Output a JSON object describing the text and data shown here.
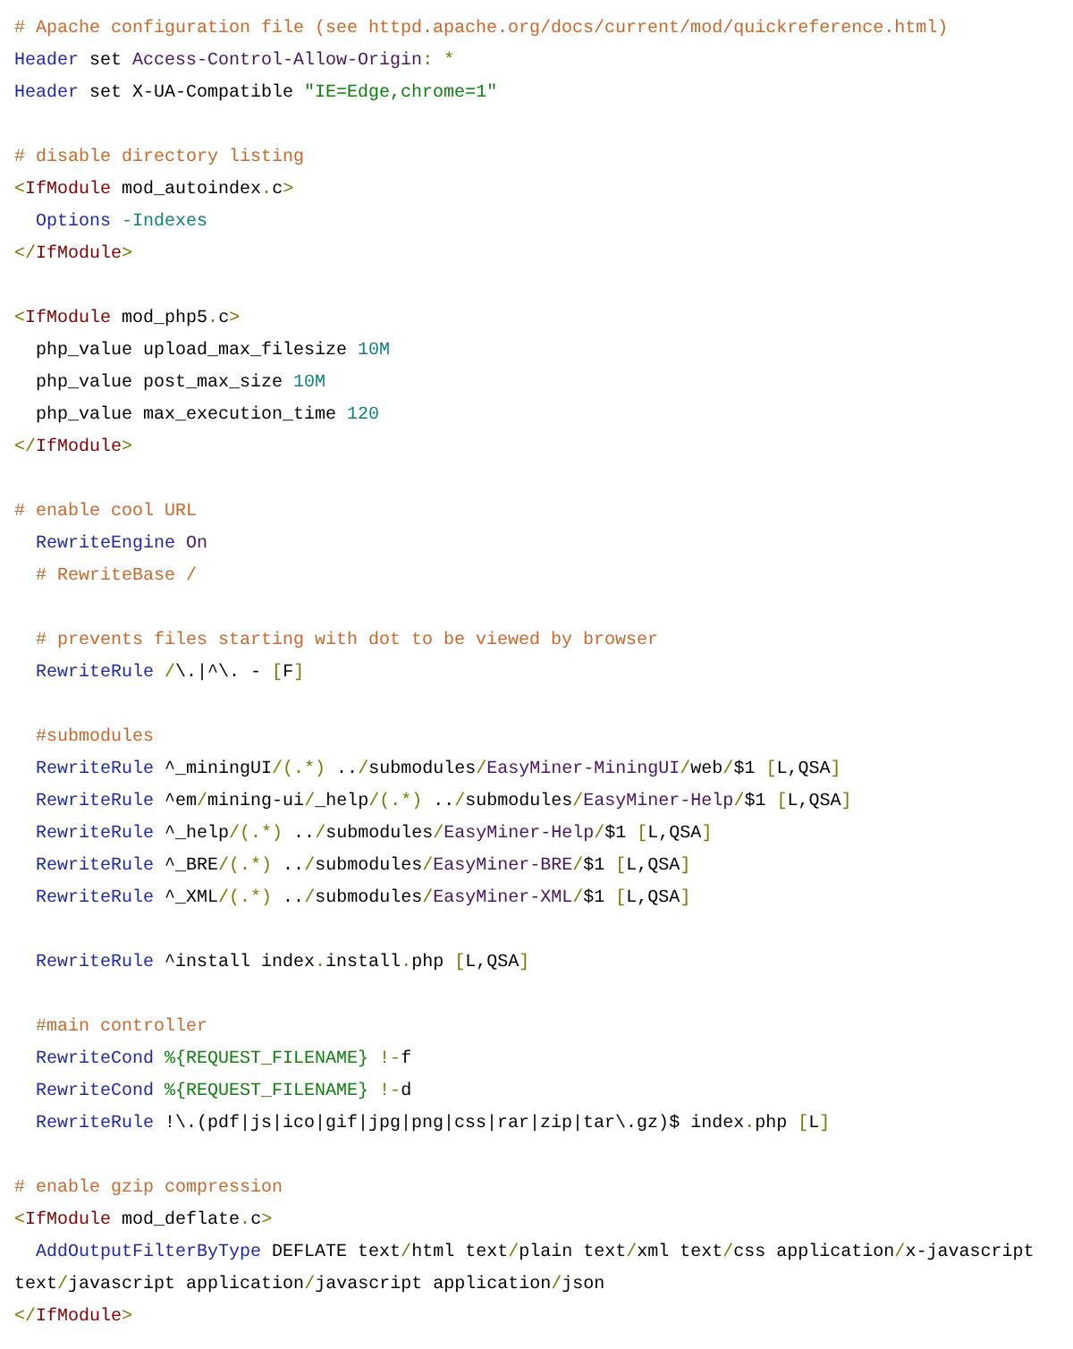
{
  "code_blocks": [
    {
      "lines": [
        {
          "indented": false,
          "tokens": [
            {
              "kind": "comment",
              "text": "# Apache configuration file (see httpd.apache.org/docs/current/mod/quickreference.html)"
            }
          ]
        },
        {
          "indented": false,
          "tokens": [
            {
              "kind": "keyword",
              "text": "Header"
            },
            {
              "kind": "text",
              "text": " set "
            },
            {
              "kind": "value",
              "text": "Access-Control-Allow-Origin"
            },
            {
              "kind": "punct",
              "text": ": *"
            }
          ]
        },
        {
          "indented": false,
          "tokens": [
            {
              "kind": "keyword",
              "text": "Header"
            },
            {
              "kind": "text",
              "text": " set X-UA-Compatible "
            },
            {
              "kind": "string",
              "text": "\"IE=Edge,chrome=1\""
            }
          ]
        }
      ]
    },
    {
      "lines": [
        {
          "indented": false,
          "tokens": [
            {
              "kind": "comment",
              "text": "# disable directory listing"
            }
          ]
        },
        {
          "indented": false,
          "tokens": [
            {
              "kind": "punct",
              "text": "<"
            },
            {
              "kind": "tag",
              "text": "IfModule"
            },
            {
              "kind": "text",
              "text": " mod_autoindex"
            },
            {
              "kind": "punct",
              "text": "."
            },
            {
              "kind": "text",
              "text": "c"
            },
            {
              "kind": "punct",
              "text": ">"
            }
          ]
        },
        {
          "indented": true,
          "tokens": [
            {
              "kind": "keyword",
              "text": "Options"
            },
            {
              "kind": "number",
              "text": " -Indexes"
            }
          ]
        },
        {
          "indented": false,
          "tokens": [
            {
              "kind": "punct",
              "text": "</"
            },
            {
              "kind": "tag",
              "text": "IfModule"
            },
            {
              "kind": "punct",
              "text": ">"
            }
          ]
        }
      ]
    },
    {
      "lines": [
        {
          "indented": false,
          "tokens": [
            {
              "kind": "punct",
              "text": "<"
            },
            {
              "kind": "tag",
              "text": "IfModule"
            },
            {
              "kind": "text",
              "text": " mod_php5"
            },
            {
              "kind": "punct",
              "text": "."
            },
            {
              "kind": "text",
              "text": "c"
            },
            {
              "kind": "punct",
              "text": ">"
            }
          ]
        },
        {
          "indented": true,
          "tokens": [
            {
              "kind": "text",
              "text": "php_value upload_max_filesize "
            },
            {
              "kind": "number",
              "text": "10M"
            }
          ]
        },
        {
          "indented": true,
          "tokens": [
            {
              "kind": "text",
              "text": "php_value post_max_size "
            },
            {
              "kind": "number",
              "text": "10M"
            }
          ]
        },
        {
          "indented": true,
          "tokens": [
            {
              "kind": "text",
              "text": "php_value max_execution_time "
            },
            {
              "kind": "number",
              "text": "120"
            }
          ]
        },
        {
          "indented": false,
          "tokens": [
            {
              "kind": "punct",
              "text": "</"
            },
            {
              "kind": "tag",
              "text": "IfModule"
            },
            {
              "kind": "punct",
              "text": ">"
            }
          ]
        }
      ]
    },
    {
      "lines": [
        {
          "indented": false,
          "tokens": [
            {
              "kind": "comment",
              "text": "# enable cool URL"
            }
          ]
        },
        {
          "indented": true,
          "tokens": [
            {
              "kind": "keyword",
              "text": "RewriteEngine"
            },
            {
              "kind": "value",
              "text": " On"
            }
          ]
        },
        {
          "indented": true,
          "tokens": [
            {
              "kind": "comment",
              "text": "# RewriteBase /"
            }
          ]
        }
      ]
    },
    {
      "lines": [
        {
          "indented": true,
          "tokens": [
            {
              "kind": "comment",
              "text": "# prevents files starting with dot to be viewed by browser"
            }
          ]
        },
        {
          "indented": true,
          "tokens": [
            {
              "kind": "keyword",
              "text": "RewriteRule"
            },
            {
              "kind": "punct",
              "text": " /"
            },
            {
              "kind": "text",
              "text": "\\.|^\\. - "
            },
            {
              "kind": "punct",
              "text": "["
            },
            {
              "kind": "text",
              "text": "F"
            },
            {
              "kind": "punct",
              "text": "]"
            }
          ]
        }
      ]
    },
    {
      "lines": [
        {
          "indented": true,
          "tokens": [
            {
              "kind": "comment",
              "text": "#submodules"
            }
          ]
        },
        {
          "indented": true,
          "tokens": [
            {
              "kind": "keyword",
              "text": "RewriteRule"
            },
            {
              "kind": "text",
              "text": " ^_miningUI"
            },
            {
              "kind": "punct",
              "text": "/(.*)"
            },
            {
              "kind": "text",
              "text": " .."
            },
            {
              "kind": "punct",
              "text": "/"
            },
            {
              "kind": "text",
              "text": "submodules"
            },
            {
              "kind": "punct",
              "text": "/"
            },
            {
              "kind": "value",
              "text": "EasyMiner-MiningUI"
            },
            {
              "kind": "punct",
              "text": "/"
            },
            {
              "kind": "text",
              "text": "web"
            },
            {
              "kind": "punct",
              "text": "/"
            },
            {
              "kind": "text",
              "text": "$1 "
            },
            {
              "kind": "punct",
              "text": "["
            },
            {
              "kind": "text",
              "text": "L,QSA"
            },
            {
              "kind": "punct",
              "text": "]"
            }
          ]
        },
        {
          "indented": true,
          "tokens": [
            {
              "kind": "keyword",
              "text": "RewriteRule"
            },
            {
              "kind": "text",
              "text": " ^em"
            },
            {
              "kind": "punct",
              "text": "/"
            },
            {
              "kind": "text",
              "text": "mining-ui"
            },
            {
              "kind": "punct",
              "text": "/"
            },
            {
              "kind": "text",
              "text": "_help"
            },
            {
              "kind": "punct",
              "text": "/(.*)"
            },
            {
              "kind": "text",
              "text": " .."
            },
            {
              "kind": "punct",
              "text": "/"
            },
            {
              "kind": "text",
              "text": "submodules"
            },
            {
              "kind": "punct",
              "text": "/"
            },
            {
              "kind": "value",
              "text": "EasyMiner-Help"
            },
            {
              "kind": "punct",
              "text": "/"
            },
            {
              "kind": "text",
              "text": "$1 "
            },
            {
              "kind": "punct",
              "text": "["
            },
            {
              "kind": "text",
              "text": "L,QSA"
            },
            {
              "kind": "punct",
              "text": "]"
            }
          ]
        },
        {
          "indented": true,
          "tokens": [
            {
              "kind": "keyword",
              "text": "RewriteRule"
            },
            {
              "kind": "text",
              "text": " ^_help"
            },
            {
              "kind": "punct",
              "text": "/(.*)"
            },
            {
              "kind": "text",
              "text": " .."
            },
            {
              "kind": "punct",
              "text": "/"
            },
            {
              "kind": "text",
              "text": "submodules"
            },
            {
              "kind": "punct",
              "text": "/"
            },
            {
              "kind": "value",
              "text": "EasyMiner-Help"
            },
            {
              "kind": "punct",
              "text": "/"
            },
            {
              "kind": "text",
              "text": "$1 "
            },
            {
              "kind": "punct",
              "text": "["
            },
            {
              "kind": "text",
              "text": "L,QSA"
            },
            {
              "kind": "punct",
              "text": "]"
            }
          ]
        },
        {
          "indented": true,
          "tokens": [
            {
              "kind": "keyword",
              "text": "RewriteRule"
            },
            {
              "kind": "text",
              "text": " ^_BRE"
            },
            {
              "kind": "punct",
              "text": "/(.*)"
            },
            {
              "kind": "text",
              "text": " .."
            },
            {
              "kind": "punct",
              "text": "/"
            },
            {
              "kind": "text",
              "text": "submodules"
            },
            {
              "kind": "punct",
              "text": "/"
            },
            {
              "kind": "value",
              "text": "EasyMiner-BRE"
            },
            {
              "kind": "punct",
              "text": "/"
            },
            {
              "kind": "text",
              "text": "$1 "
            },
            {
              "kind": "punct",
              "text": "["
            },
            {
              "kind": "text",
              "text": "L,QSA"
            },
            {
              "kind": "punct",
              "text": "]"
            }
          ]
        },
        {
          "indented": true,
          "tokens": [
            {
              "kind": "keyword",
              "text": "RewriteRule"
            },
            {
              "kind": "text",
              "text": " ^_XML"
            },
            {
              "kind": "punct",
              "text": "/(.*)"
            },
            {
              "kind": "text",
              "text": " .."
            },
            {
              "kind": "punct",
              "text": "/"
            },
            {
              "kind": "text",
              "text": "submodules"
            },
            {
              "kind": "punct",
              "text": "/"
            },
            {
              "kind": "value",
              "text": "EasyMiner-XML"
            },
            {
              "kind": "punct",
              "text": "/"
            },
            {
              "kind": "text",
              "text": "$1 "
            },
            {
              "kind": "punct",
              "text": "["
            },
            {
              "kind": "text",
              "text": "L,QSA"
            },
            {
              "kind": "punct",
              "text": "]"
            }
          ]
        }
      ]
    },
    {
      "lines": [
        {
          "indented": true,
          "tokens": [
            {
              "kind": "keyword",
              "text": "RewriteRule"
            },
            {
              "kind": "text",
              "text": " ^install index"
            },
            {
              "kind": "punct",
              "text": "."
            },
            {
              "kind": "text",
              "text": "install"
            },
            {
              "kind": "punct",
              "text": "."
            },
            {
              "kind": "text",
              "text": "php "
            },
            {
              "kind": "punct",
              "text": "["
            },
            {
              "kind": "text",
              "text": "L,QSA"
            },
            {
              "kind": "punct",
              "text": "]"
            }
          ]
        }
      ]
    },
    {
      "lines": [
        {
          "indented": true,
          "tokens": [
            {
              "kind": "comment",
              "text": "#main controller"
            }
          ]
        },
        {
          "indented": true,
          "tokens": [
            {
              "kind": "keyword",
              "text": "RewriteCond"
            },
            {
              "kind": "string",
              "text": " %{REQUEST_FILENAME}"
            },
            {
              "kind": "punct",
              "text": " !-"
            },
            {
              "kind": "text",
              "text": "f"
            }
          ]
        },
        {
          "indented": true,
          "tokens": [
            {
              "kind": "keyword",
              "text": "RewriteCond"
            },
            {
              "kind": "string",
              "text": " %{REQUEST_FILENAME}"
            },
            {
              "kind": "punct",
              "text": " !-"
            },
            {
              "kind": "text",
              "text": "d"
            }
          ]
        },
        {
          "indented": true,
          "tokens": [
            {
              "kind": "keyword",
              "text": "RewriteRule"
            },
            {
              "kind": "text",
              "text": " !\\.(pdf|js|ico|gif|jpg|png|css|rar|zip|tar\\.gz)$ index"
            },
            {
              "kind": "punct",
              "text": "."
            },
            {
              "kind": "text",
              "text": "php "
            },
            {
              "kind": "punct",
              "text": "["
            },
            {
              "kind": "text",
              "text": "L"
            },
            {
              "kind": "punct",
              "text": "]"
            }
          ]
        }
      ]
    },
    {
      "lines": [
        {
          "indented": false,
          "tokens": [
            {
              "kind": "comment",
              "text": "# enable gzip compression"
            }
          ]
        },
        {
          "indented": false,
          "tokens": [
            {
              "kind": "punct",
              "text": "<"
            },
            {
              "kind": "tag",
              "text": "IfModule"
            },
            {
              "kind": "text",
              "text": " mod_deflate"
            },
            {
              "kind": "punct",
              "text": "."
            },
            {
              "kind": "text",
              "text": "c"
            },
            {
              "kind": "punct",
              "text": ">"
            }
          ]
        },
        {
          "indented": true,
          "tokens": [
            {
              "kind": "keyword",
              "text": "AddOutputFilterByType"
            },
            {
              "kind": "text",
              "text": " DEFLATE text"
            },
            {
              "kind": "punct",
              "text": "/"
            },
            {
              "kind": "text",
              "text": "html text"
            },
            {
              "kind": "punct",
              "text": "/"
            },
            {
              "kind": "text",
              "text": "plain text"
            },
            {
              "kind": "punct",
              "text": "/"
            },
            {
              "kind": "text",
              "text": "xml text"
            },
            {
              "kind": "punct",
              "text": "/"
            },
            {
              "kind": "text",
              "text": "css application"
            },
            {
              "kind": "punct",
              "text": "/"
            },
            {
              "kind": "text",
              "text": "x-javascript text"
            },
            {
              "kind": "punct",
              "text": "/"
            },
            {
              "kind": "text",
              "text": "javascript application"
            },
            {
              "kind": "punct",
              "text": "/"
            },
            {
              "kind": "text",
              "text": "javascript application"
            },
            {
              "kind": "punct",
              "text": "/"
            },
            {
              "kind": "text",
              "text": "json"
            }
          ]
        },
        {
          "indented": false,
          "tokens": [
            {
              "kind": "punct",
              "text": "</"
            },
            {
              "kind": "tag",
              "text": "IfModule"
            },
            {
              "kind": "punct",
              "text": ">"
            }
          ]
        }
      ]
    }
  ]
}
